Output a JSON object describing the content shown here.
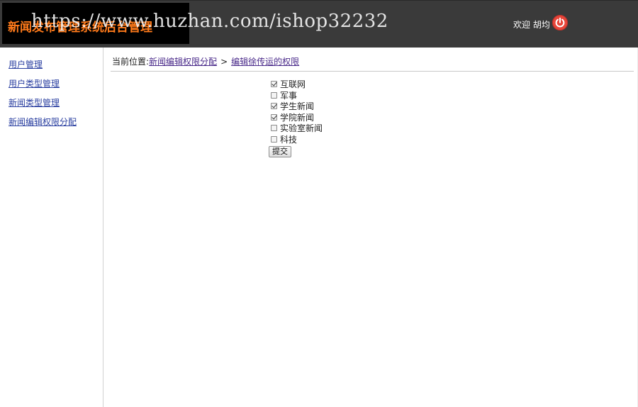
{
  "header": {
    "title": "新闻发布管理系统后台管理",
    "watermark": "https://www.huzhan.com/ishop32232",
    "welcome": "欢迎 胡均"
  },
  "sidebar": {
    "items": [
      {
        "label": "用户管理"
      },
      {
        "label": "用户类型管理"
      },
      {
        "label": "新闻类型管理"
      },
      {
        "label": "新闻编辑权限分配"
      }
    ]
  },
  "breadcrumb": {
    "prefix": "当前位置:",
    "link1": "新闻编辑权限分配",
    "separator": ">",
    "link2": "编辑徐传运的权限"
  },
  "permissions": [
    {
      "label": "互联网",
      "checked": true
    },
    {
      "label": "军事",
      "checked": false
    },
    {
      "label": "学生新闻",
      "checked": true
    },
    {
      "label": "学院新闻",
      "checked": true
    },
    {
      "label": "实验室新闻",
      "checked": false
    },
    {
      "label": "科技",
      "checked": false
    }
  ],
  "form": {
    "submit_label": "提交"
  },
  "colors": {
    "header_bg": "#3a3a3a",
    "logo_title": "#ff7a1a",
    "link": "#2a3fa0",
    "power_button": "#e8463a"
  },
  "icons": {
    "power": "power-icon"
  }
}
